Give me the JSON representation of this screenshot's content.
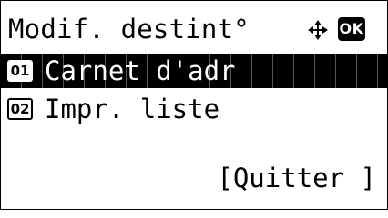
{
  "screen": {
    "title": "Modif. destint°",
    "nav_icon": "four-way-arrow-icon",
    "ok_label": "OK"
  },
  "menu": {
    "items": [
      {
        "number": "01",
        "label": "Carnet d'adr",
        "selected": true
      },
      {
        "number": "02",
        "label": "Impr. liste",
        "selected": false
      }
    ]
  },
  "softkeys": {
    "right_label": "[Quitter ]"
  },
  "colors": {
    "background": "#ffffff",
    "foreground": "#000000"
  }
}
